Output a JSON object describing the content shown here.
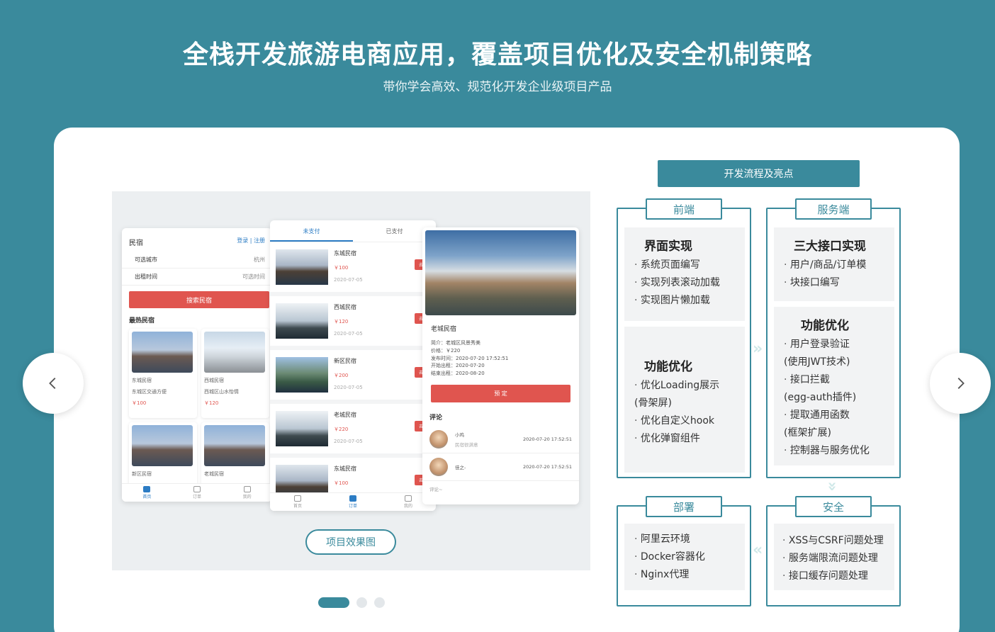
{
  "hero": {
    "title": "全栈开发旅游电商应用，覆盖项目优化及安全机制策略",
    "subtitle": "带你学会高效、规范化开发企业级项目产品"
  },
  "slider": {
    "effect_button": "项目效果图"
  },
  "phone_list": {
    "title": "民宿",
    "login": "登录 | 注册",
    "city_label": "可选城市",
    "city_value": "杭州",
    "time_label": "出租时间",
    "time_value": "可选时间",
    "search_button": "搜索民宿",
    "hot_title": "最热民宿",
    "cards": [
      {
        "name": "东城民宿",
        "desc": "东城区交通方便",
        "price": "￥100"
      },
      {
        "name": "西城民宿",
        "desc": "西城区山水怡情",
        "price": "￥120"
      },
      {
        "name": "新区民宿",
        "desc": "",
        "price": ""
      },
      {
        "name": "老城民宿",
        "desc": "",
        "price": ""
      }
    ],
    "tabs": [
      "首页",
      "订单",
      "我的"
    ]
  },
  "phone_orders": {
    "tab_unpaid": "未支付",
    "tab_paid": "已支付",
    "orders": [
      {
        "name": "东城民宿",
        "price": "￥100",
        "date": "2020-07-05",
        "action": "去支付"
      },
      {
        "name": "西城民宿",
        "price": "￥120",
        "date": "2020-07-05",
        "action": "去支付"
      },
      {
        "name": "新区民宿",
        "price": "￥200",
        "date": "2020-07-05",
        "action": "去支付"
      },
      {
        "name": "老城民宿",
        "price": "￥220",
        "date": "2020-07-05",
        "action": "去支付"
      },
      {
        "name": "东城民宿",
        "price": "￥100",
        "date": "",
        "action": "去支付"
      }
    ],
    "tabs": [
      "首页",
      "订单",
      "我的"
    ]
  },
  "phone_detail": {
    "name": "老城民宿",
    "intro": "简介：老城区风景秀美",
    "price": "价格：￥220",
    "publish": "发布时间：2020-07-20 17:52:51",
    "start": "开始出租：2020-07-20",
    "end": "结束出租：2020-08-20",
    "book_button": "预 定",
    "comments_title": "评论",
    "comments": [
      {
        "user": "小鸡",
        "text": "民宿很满意",
        "time": "2020-07-20 17:52:51"
      },
      {
        "user": "佳之-",
        "text": "",
        "time": "2020-07-20 17:52:51"
      }
    ],
    "comment_input": "评论~"
  },
  "flow": {
    "title": "开发流程及亮点",
    "frontend": {
      "label": "前端",
      "panels": [
        {
          "title": "界面实现",
          "items": [
            "系统页面编写",
            "实现列表滚动加载",
            "实现图片懒加载"
          ]
        },
        {
          "title": "功能优化",
          "items": [
            "优化Loading展示",
            "(骨架屏)",
            "优化自定义hook",
            "优化弹窗组件"
          ]
        }
      ]
    },
    "backend": {
      "label": "服务端",
      "panels": [
        {
          "title": "三大接口实现",
          "items": [
            "用户/商品/订单模",
            "块接口编写"
          ]
        },
        {
          "title": "功能优化",
          "items": [
            "用户登录验证",
            "(使用JWT技术)",
            "接口拦截",
            "(egg-auth插件)",
            "提取通用函数",
            "(框架扩展)",
            "控制器与服务优化"
          ]
        }
      ]
    },
    "deploy": {
      "label": "部署",
      "items": [
        "阿里云环境",
        "Docker容器化",
        "Nginx代理"
      ]
    },
    "security": {
      "label": "安全",
      "items": [
        "XSS与CSRF问题处理",
        "服务端限流问题处理",
        "接口缓存问题处理"
      ]
    }
  },
  "colors": {
    "brand": "#3a8a9c",
    "accent": "#e0554f"
  }
}
